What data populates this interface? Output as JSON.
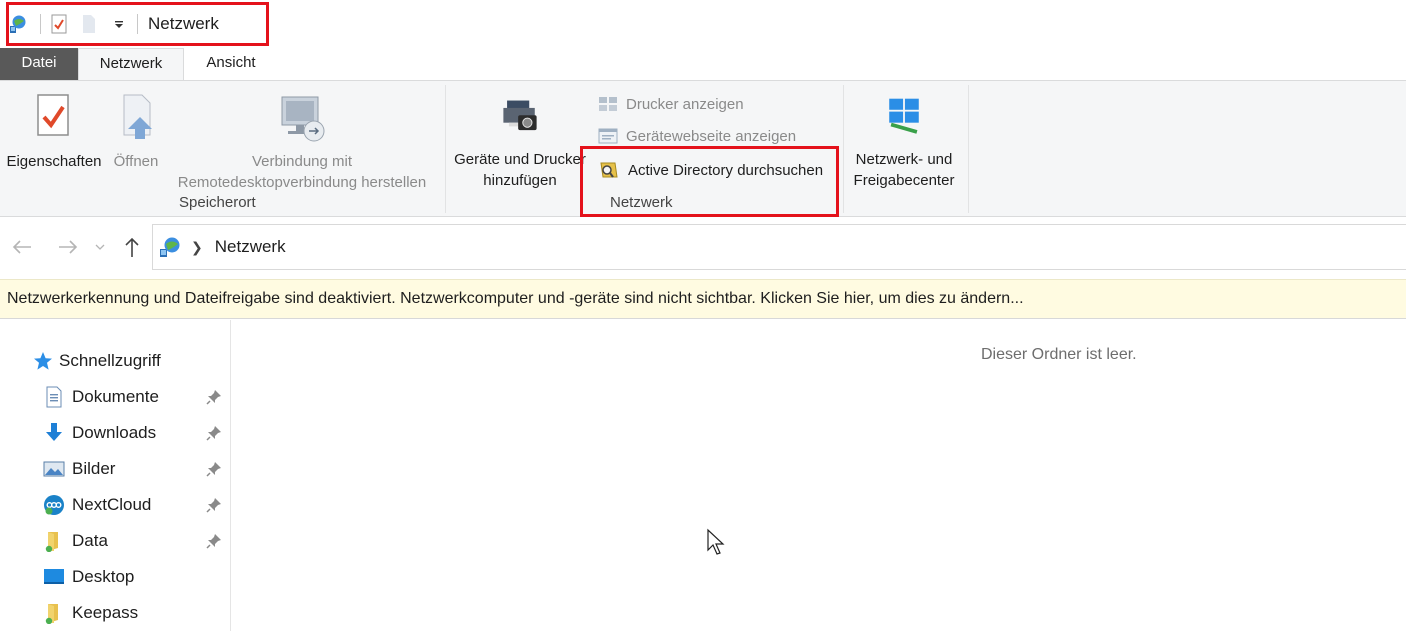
{
  "window": {
    "title": "Netzwerk"
  },
  "tabs": [
    {
      "label": "Datei"
    },
    {
      "label": "Netzwerk"
    },
    {
      "label": "Ansicht"
    }
  ],
  "ribbon": {
    "location_group": {
      "label": "Speicherort",
      "properties": "Eigenschaften",
      "open": "Öffnen",
      "remote_line1": "Verbindung mit",
      "remote_line2": "Remotedesktopverbindung herstellen"
    },
    "network_group": {
      "label": "Netzwerk",
      "add_devices_line1": "Geräte und Drucker",
      "add_devices_line2": "hinzufügen",
      "show_printers": "Drucker anzeigen",
      "show_device_webpage": "Gerätewebseite anzeigen",
      "search_ad": "Active Directory durchsuchen"
    },
    "center_group": {
      "line1": "Netzwerk- und",
      "line2": "Freigabecenter"
    }
  },
  "address": {
    "crumb": "Netzwerk"
  },
  "infobar": {
    "text": "Netzwerkerkennung und Dateifreigabe sind deaktiviert. Netzwerkcomputer und -geräte sind nicht sichtbar. Klicken Sie hier, um dies zu ändern..."
  },
  "sidebar": {
    "items": [
      {
        "label": "Schnellzugriff",
        "icon": "star-icon"
      },
      {
        "label": "Dokumente",
        "icon": "document-icon",
        "pinned": true
      },
      {
        "label": "Downloads",
        "icon": "download-arrow-icon",
        "pinned": true
      },
      {
        "label": "Bilder",
        "icon": "pictures-icon",
        "pinned": true
      },
      {
        "label": "NextCloud",
        "icon": "nextcloud-icon",
        "pinned": true
      },
      {
        "label": "Data",
        "icon": "folder-icon",
        "pinned": true
      },
      {
        "label": "Desktop",
        "icon": "desktop-icon"
      },
      {
        "label": "Keepass",
        "icon": "folder-icon"
      }
    ]
  },
  "content": {
    "empty_message": "Dieser Ordner ist leer."
  },
  "colors": {
    "highlight_frame": "#e4121b",
    "file_tab_bg": "#595959",
    "infobar_bg": "#fffbe1",
    "accent_blue": "#1e7fd6"
  }
}
